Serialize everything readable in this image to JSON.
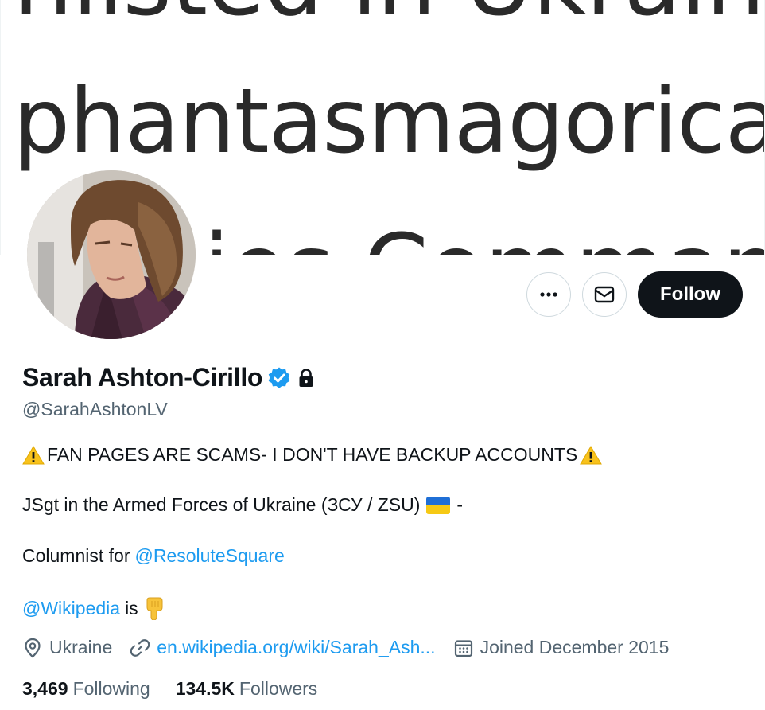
{
  "banner": {
    "line_top": "nlisted in Ukraine's",
    "line_mid": "phantasmagorical",
    "line_bot": "Armies Command"
  },
  "actions": {
    "more_icon": "ellipsis-icon",
    "message_icon": "envelope-icon",
    "follow_label": "Follow"
  },
  "profile": {
    "name": "Sarah Ashton-Cirillo",
    "handle": "@SarahAshtonLV",
    "verified_icon": "verified-badge-icon",
    "lock_icon": "lock-icon"
  },
  "bio": {
    "line1": "FAN PAGES ARE SCAMS- I DON'T HAVE BACKUP ACCOUNTS",
    "line2_text": "JSgt in the Armed Forces of Ukraine (ЗСУ / ZSU)",
    "line2_suffix": "-",
    "line3_text": "Columnist for",
    "line3_link": "@ResoluteSquare",
    "line4_link": "@Wikipedia",
    "line4_text": "is"
  },
  "meta": {
    "location": "Ukraine",
    "url": "en.wikipedia.org/wiki/Sarah_Ash...",
    "joined": "Joined December 2015"
  },
  "stats": {
    "following_count": "3,469",
    "following_label": "Following",
    "followers_count": "134.5K",
    "followers_label": "Followers"
  },
  "colors": {
    "link": "#1d9bf0",
    "follow_bg": "#0f1419",
    "verified": "#1d9bf0",
    "secondary_text": "#536471"
  }
}
